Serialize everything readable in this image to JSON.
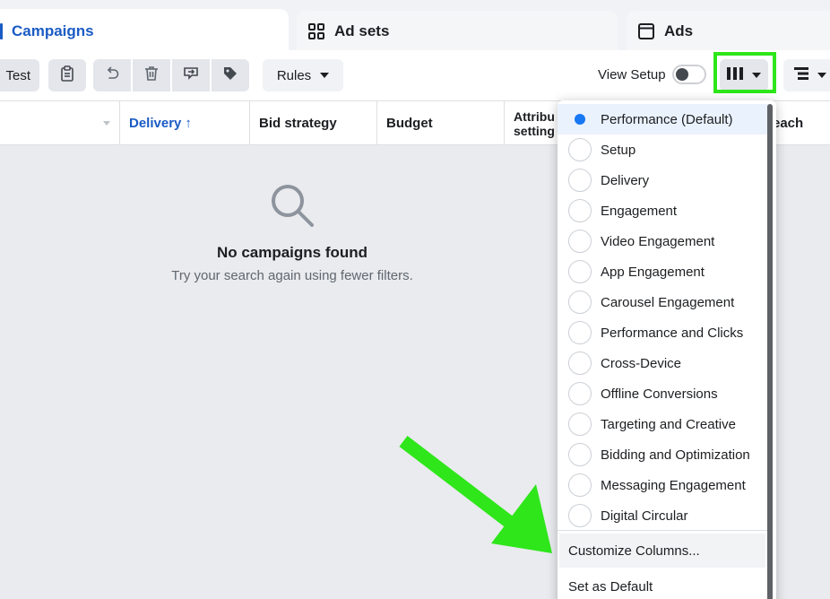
{
  "tabs": {
    "campaigns": "Campaigns",
    "adsets": "Ad sets",
    "ads": "Ads"
  },
  "toolbar": {
    "test_label": "Test",
    "rules_label": "Rules",
    "view_setup_label": "View Setup"
  },
  "table": {
    "headers": {
      "delivery": "Delivery",
      "delivery_sort": "↑",
      "bid_strategy": "Bid strategy",
      "budget": "Budget",
      "attribution_line1": "Attribu",
      "attribution_line2": "setting",
      "reach": "each"
    }
  },
  "empty_state": {
    "title": "No campaigns found",
    "subtitle": "Try your search again using fewer filters."
  },
  "columns_menu": {
    "items": [
      "Performance (Default)",
      "Setup",
      "Delivery",
      "Engagement",
      "Video Engagement",
      "App Engagement",
      "Carousel Engagement",
      "Performance and Clicks",
      "Cross-Device",
      "Offline Conversions",
      "Targeting and Creative",
      "Bidding and Optimization",
      "Messaging Engagement",
      "Digital Circular"
    ],
    "selected_index": 0,
    "customize_label": "Customize Columns...",
    "default_label": "Set as Default"
  },
  "colors": {
    "accent": "#1a5bc4",
    "radio_selected": "#1877f2",
    "highlight_green": "#2ee61a"
  }
}
